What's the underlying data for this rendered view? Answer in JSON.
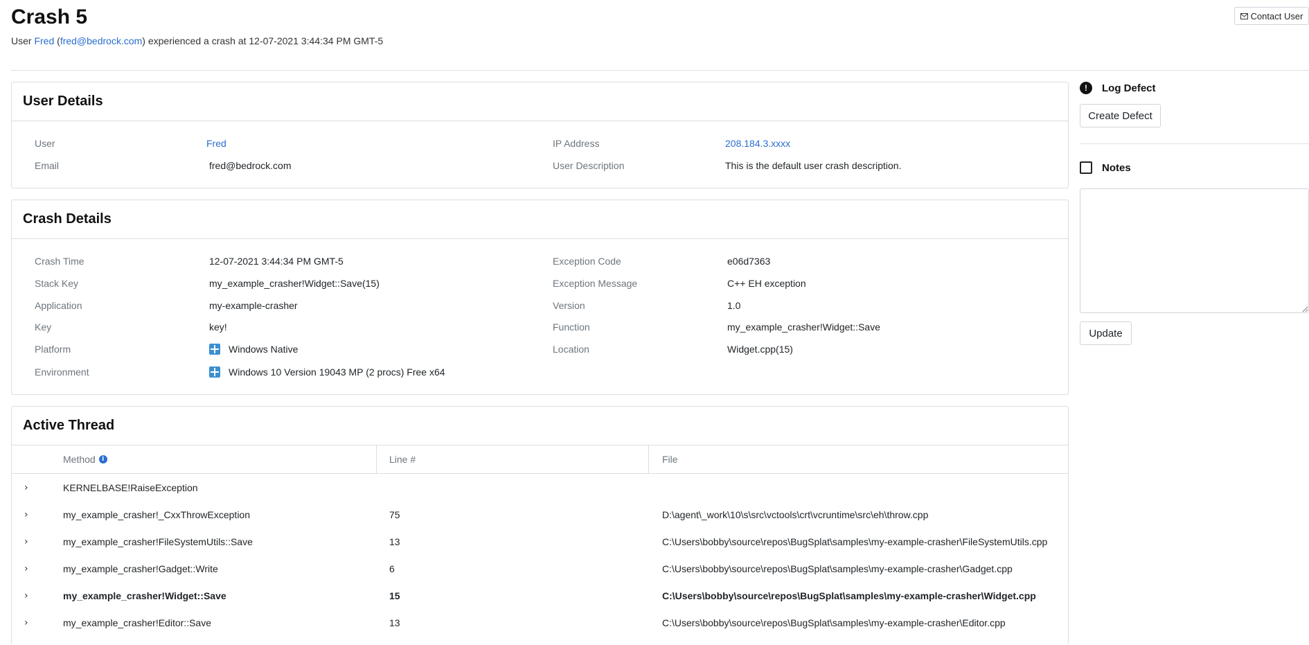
{
  "header": {
    "title": "Crash 5",
    "subtitle": {
      "prefix": "User ",
      "user_name": "Fred",
      "open_paren": " (",
      "email": "fred@bedrock.com",
      "suffix": ") experienced a crash at 12-07-2021 3:44:34 PM GMT-5"
    },
    "contact_label": "Contact User"
  },
  "user_details": {
    "title": "User Details",
    "user_label": "User",
    "user_value": "Fred",
    "email_label": "Email",
    "email_value": "fred@bedrock.com",
    "ip_label": "IP Address",
    "ip_value": "208.184.3.xxxx",
    "desc_label": "User Description",
    "desc_value": "This is the default user crash description."
  },
  "crash_details": {
    "title": "Crash Details",
    "crash_time_label": "Crash Time",
    "crash_time_value": "12-07-2021 3:44:34 PM GMT-5",
    "stack_key_label": "Stack Key",
    "stack_key_value": "my_example_crasher!Widget::Save(15)",
    "application_label": "Application",
    "application_value": "my-example-crasher",
    "key_label": "Key",
    "key_value": "key!",
    "platform_label": "Platform",
    "platform_value": "Windows Native",
    "environment_label": "Environment",
    "environment_value": "Windows 10 Version 19043 MP (2 procs) Free x64",
    "exception_code_label": "Exception Code",
    "exception_code_value": "e06d7363",
    "exception_message_label": "Exception Message",
    "exception_message_value": "C++ EH exception",
    "version_label": "Version",
    "version_value": "1.0",
    "function_label": "Function",
    "function_value": "my_example_crasher!Widget::Save",
    "location_label": "Location",
    "location_value": "Widget.cpp(15)"
  },
  "active_thread": {
    "title": "Active Thread",
    "columns": {
      "method": "Method",
      "line": "Line #",
      "file": "File"
    },
    "rows": [
      {
        "method": "KERNELBASE!RaiseException",
        "line": "",
        "file": ""
      },
      {
        "method": "my_example_crasher!_CxxThrowException",
        "line": "75",
        "file": "D:\\agent\\_work\\10\\s\\src\\vctools\\crt\\vcruntime\\src\\eh\\throw.cpp"
      },
      {
        "method": "my_example_crasher!FileSystemUtils::Save",
        "line": "13",
        "file": "C:\\Users\\bobby\\source\\repos\\BugSplat\\samples\\my-example-crasher\\FileSystemUtils.cpp"
      },
      {
        "method": "my_example_crasher!Gadget::Write",
        "line": "6",
        "file": "C:\\Users\\bobby\\source\\repos\\BugSplat\\samples\\my-example-crasher\\Gadget.cpp"
      },
      {
        "method": "my_example_crasher!Widget::Save",
        "line": "15",
        "file": "C:\\Users\\bobby\\source\\repos\\BugSplat\\samples\\my-example-crasher\\Widget.cpp"
      },
      {
        "method": "my_example_crasher!Editor::Save",
        "line": "13",
        "file": "C:\\Users\\bobby\\source\\repos\\BugSplat\\samples\\my-example-crasher\\Editor.cpp"
      }
    ]
  },
  "sidebar": {
    "log_defect_title": "Log Defect",
    "create_defect_label": "Create Defect",
    "notes_title": "Notes",
    "notes_value": "",
    "update_label": "Update"
  }
}
